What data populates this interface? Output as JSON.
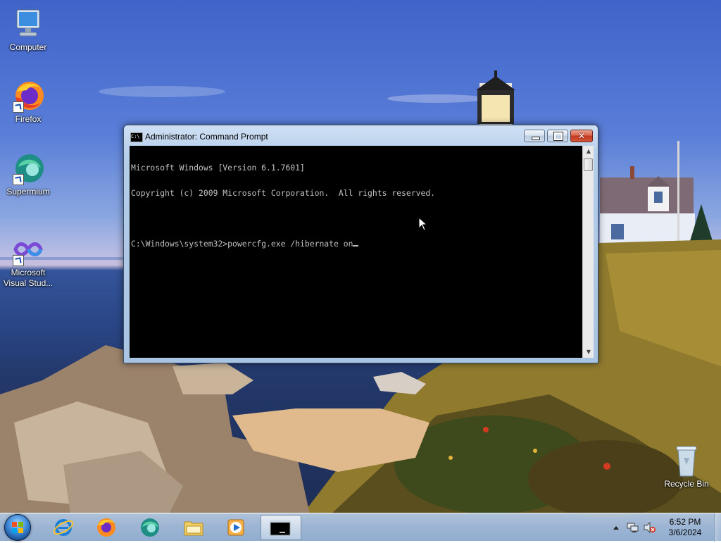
{
  "desktop": {
    "icons": [
      {
        "label": "Computer"
      },
      {
        "label": "Firefox"
      },
      {
        "label": "Supermium"
      },
      {
        "label": "Microsoft Visual Stud..."
      },
      {
        "label": "Recycle Bin"
      }
    ]
  },
  "window": {
    "title": "Administrator:  Command Prompt",
    "icon_text": "C:\\",
    "close_glyph": "✕",
    "console_lines": [
      "Microsoft Windows [Version 6.1.7601]",
      "Copyright (c) 2009 Microsoft Corporation.  All rights reserved.",
      "",
      "C:\\Windows\\system32>powercfg.exe /hibernate on"
    ],
    "scroll_up": "▲",
    "scroll_down": "▼"
  },
  "taskbar": {
    "items": [
      "Start",
      "Internet Explorer",
      "Firefox",
      "Supermium",
      "File Explorer",
      "Windows Media Player",
      "Command Prompt"
    ],
    "cmd_task_text": "C:\\"
  },
  "clock": {
    "time": "6:52 PM",
    "date": "3/6/2024"
  },
  "colors": {
    "console_bg": "#000000",
    "console_fg": "#c0c0c0",
    "titlebar": "#b4cde9",
    "close_red": "#c2391f"
  }
}
